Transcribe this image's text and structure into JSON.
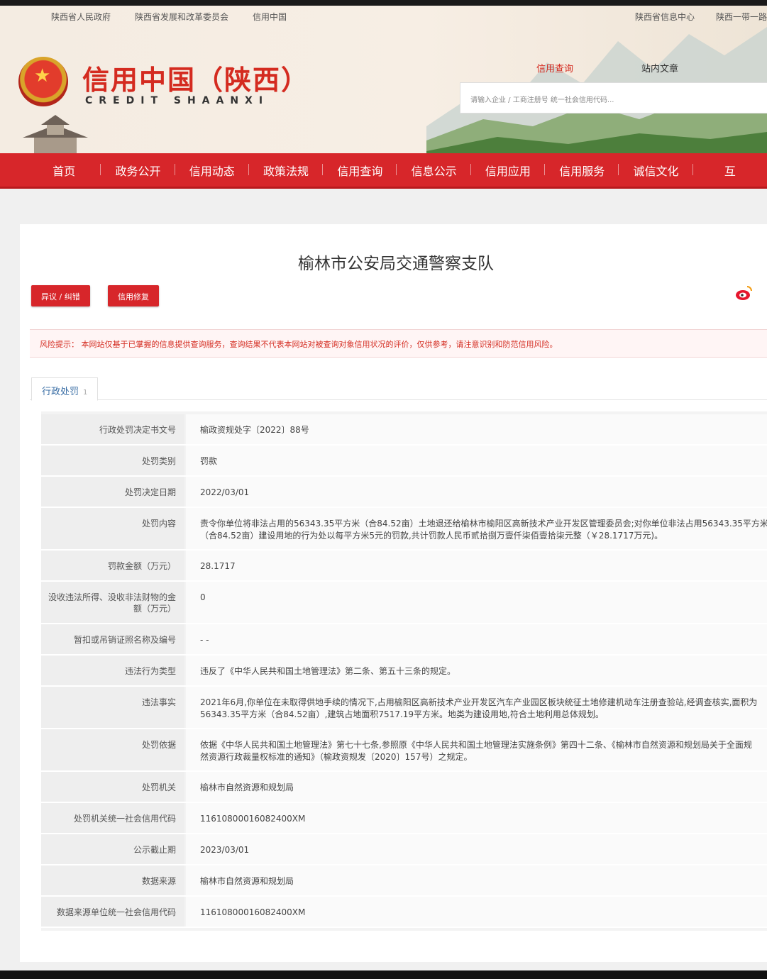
{
  "header": {
    "top_links_left": [
      "陕西省人民政府",
      "陕西省发展和改革委员会",
      "信用中国"
    ],
    "top_links_right": [
      "陕西省信息中心",
      "陕西一带一路"
    ],
    "logo_title": "信用中国（陕西）",
    "logo_sub": "CREDIT   SHAANXI",
    "search_tabs": [
      "信用查询",
      "站内文章"
    ],
    "search_placeholder": "请输入企业 / 工商注册号 统一社会信用代码..."
  },
  "nav": [
    "首页",
    "政务公开",
    "信用动态",
    "政策法规",
    "信用查询",
    "信息公示",
    "信用应用",
    "信用服务",
    "诚信文化",
    "互"
  ],
  "main": {
    "org_title": "榆林市公安局交通警察支队",
    "btn_objection": "异议 / 纠错",
    "btn_repair": "信用修复",
    "risk_notice": "风险提示：  本网站仅基于已掌握的信息提供查询服务，查询结果不代表本网站对被查询对象信用状况的评价，仅供参考，请注意识别和防范信用风险。",
    "tab_label": "行政处罚",
    "tab_count": "1"
  },
  "rows": [
    {
      "label": "行政处罚决定书文号",
      "value": [
        "榆政资规处字〔2022〕88号"
      ]
    },
    {
      "label": "处罚类别",
      "value": [
        "罚款"
      ]
    },
    {
      "label": "处罚决定日期",
      "value": [
        "2022/03/01"
      ]
    },
    {
      "label": "处罚内容",
      "value": [
        "责令你单位将非法占用的56343.35平方米（合84.52亩）土地退还给榆林市榆阳区高新技术产业开发区管理委员会;对你单位非法占用56343.35平方米",
        "（合84.52亩）建设用地的行为处以每平方米5元的罚款,共计罚款人民币贰拾捌万壹仟柒佰壹拾柒元整（￥28.1717万元)。"
      ]
    },
    {
      "label": "罚款金额（万元）",
      "value": [
        "28.1717"
      ]
    },
    {
      "label": "没收违法所得、没收非法财物的金额（万元）",
      "value": [
        "0"
      ]
    },
    {
      "label": "暂扣或吊销证照名称及编号",
      "value": [
        "- -"
      ]
    },
    {
      "label": "违法行为类型",
      "value": [
        "违反了《中华人民共和国土地管理法》第二条、第五十三条的规定。"
      ]
    },
    {
      "label": "违法事实",
      "value": [
        "2021年6月,你单位在未取得供地手续的情况下,占用榆阳区高新技术产业开发区汽车产业园区板块统征土地修建机动车注册查验站,经调查核实,面积为",
        "56343.35平方米（合84.52亩）,建筑占地面积7517.19平方米。地类为建设用地,符合土地利用总体规划。"
      ]
    },
    {
      "label": "处罚依据",
      "value": [
        "依据《中华人民共和国土地管理法》第七十七条,参照原《中华人民共和国土地管理法实施条例》第四十二条、《榆林市自然资源和规划局关于全面规",
        "然资源行政裁量权标准的通知》（榆政资规发〔2020〕157号）之规定。"
      ]
    },
    {
      "label": "处罚机关",
      "value": [
        "榆林市自然资源和规划局"
      ]
    },
    {
      "label": "处罚机关统一社会信用代码",
      "value": [
        "11610800016082400XM"
      ]
    },
    {
      "label": "公示截止期",
      "value": [
        "2023/03/01"
      ]
    },
    {
      "label": "数据来源",
      "value": [
        "榆林市自然资源和规划局"
      ]
    },
    {
      "label": "数据来源单位统一社会信用代码",
      "value": [
        "11610800016082400XM"
      ]
    }
  ]
}
